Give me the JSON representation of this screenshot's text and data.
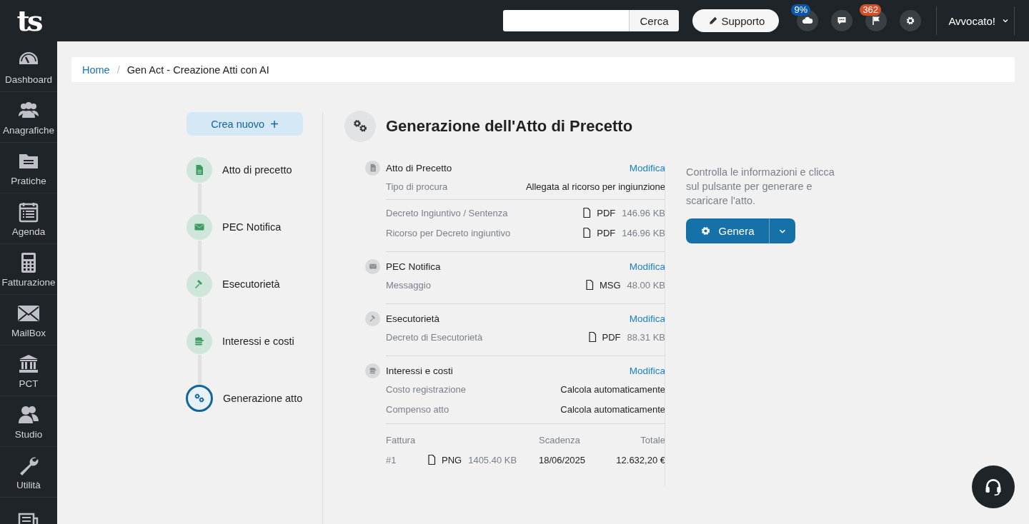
{
  "topbar": {
    "logo": "ts",
    "search": {
      "button": "Cerca"
    },
    "support_button": "Supporto",
    "icon_buttons": [
      {
        "kind": "cloud",
        "badge": "9%",
        "color": "#0b58a8"
      },
      {
        "kind": "chat"
      },
      {
        "kind": "flag",
        "badge": "362",
        "color": "#d4502a"
      },
      {
        "kind": "settings"
      }
    ],
    "user_menu": "Avvocato!"
  },
  "sidebar": {
    "items": [
      {
        "kind": "dashboard",
        "label": "Dashboard"
      },
      {
        "kind": "people",
        "label": "Anagrafiche"
      },
      {
        "kind": "folder",
        "label": "Pratiche"
      },
      {
        "kind": "calendar",
        "label": "Agenda"
      },
      {
        "kind": "calculator",
        "label": "Fatturazione"
      },
      {
        "kind": "mail",
        "label": "MailBox"
      },
      {
        "kind": "bank",
        "label": "PCT"
      },
      {
        "kind": "team",
        "label": "Studio"
      },
      {
        "kind": "wrench",
        "label": "Utilità"
      },
      {
        "kind": "news"
      }
    ]
  },
  "breadcrumb": {
    "separator": "/",
    "items": [
      {
        "kind": "link",
        "label": "Home"
      },
      {
        "kind": "current",
        "label": "Gen Act - Creazione Atti con AI"
      }
    ]
  },
  "steps": {
    "new_button": "Crea nuovo",
    "new_icon": "+",
    "items": [
      {
        "kind": "document",
        "label": "Atto di precetto",
        "selected": false
      },
      {
        "kind": "envelope",
        "label": "PEC Notifica",
        "selected": false
      },
      {
        "kind": "gavel",
        "label": "Esecutorietà",
        "selected": false
      },
      {
        "kind": "coins",
        "label": "Interessi e costi",
        "selected": false
      },
      {
        "kind": "gears",
        "label": "Generazione atto",
        "selected": true
      }
    ]
  },
  "summary": {
    "title": "Generazione dell'Atto di Precetto",
    "sections": [
      {
        "kind": "document",
        "title": "Atto di Precetto",
        "action": "Modifica",
        "groups": [
          [
            {
              "kind": "text",
              "label": "Tipo di procura",
              "value": "Allegata al ricorso per ingiunzione"
            }
          ],
          [
            {
              "kind": "file",
              "label": "Decreto Ingiuntivo / Sentenza",
              "file_type": "PDF",
              "size": "146.96 KB"
            },
            {
              "kind": "file",
              "label": "Ricorso per Decreto ingiuntivo",
              "file_type": "PDF",
              "size": "146.96 KB"
            }
          ]
        ]
      },
      {
        "kind": "envelope",
        "title": "PEC Notifica",
        "action": "Modifica",
        "groups": [
          [
            {
              "kind": "file",
              "label": "Messaggio",
              "file_type": "MSG",
              "size": "48.00 KB"
            }
          ]
        ]
      },
      {
        "kind": "gavel",
        "title": "Esecutorietà",
        "action": "Modifica",
        "groups": [
          [
            {
              "kind": "file",
              "label": "Decreto di Esecutorietà",
              "file_type": "PDF",
              "size": "88.31 KB"
            }
          ]
        ]
      },
      {
        "kind": "coins",
        "title": "Interessi e costi",
        "action": "Modifica",
        "groups": [
          [
            {
              "kind": "text",
              "label": "Costo registrazione",
              "value": "Calcola automaticamente"
            },
            {
              "kind": "text",
              "label": "Compenso atto",
              "value": "Calcola automaticamente"
            }
          ]
        ],
        "invoices": {
          "columns": [
            "Fattura",
            "Scadenza",
            "Totale"
          ],
          "rows": [
            {
              "number": "#1",
              "file_type": "PNG",
              "size": "1405.40 KB",
              "due": "18/06/2025",
              "total": "12.632,20 €"
            }
          ]
        }
      }
    ]
  },
  "generate_panel": {
    "text": "Controlla le informazioni e clicca sul pulsante per generare e scaricare l'atto.",
    "button": "Genera"
  }
}
